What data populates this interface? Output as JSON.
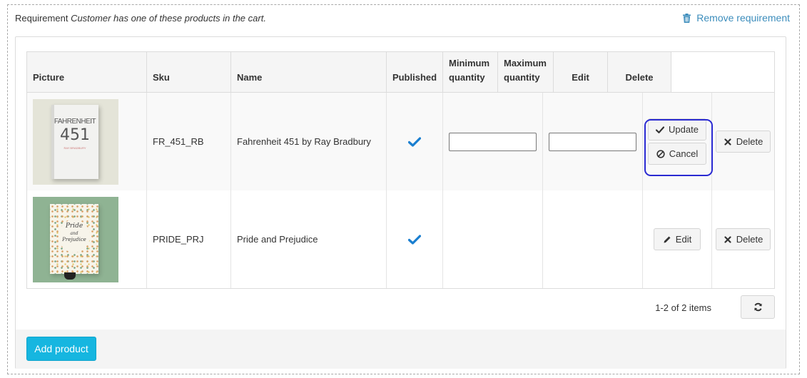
{
  "requirement": {
    "prefix": "Requirement",
    "description": "Customer has one of these products in the cart.",
    "remove_label": "Remove requirement"
  },
  "table": {
    "columns": {
      "picture": "Picture",
      "sku": "Sku",
      "name": "Name",
      "published": "Published",
      "min_qty_line1": "Minimum",
      "min_qty_line2": "quantity",
      "max_qty_line1": "Maximum",
      "max_qty_line2": "quantity",
      "edit": "Edit",
      "delete": "Delete"
    },
    "rows": [
      {
        "sku": "FR_451_RB",
        "name": "Fahrenheit 451 by Ray Bradbury",
        "published": true,
        "picture_title_line1": "FAHRENHEIT",
        "picture_title_line2": "451",
        "picture_author": "RAY BRADBURY",
        "min_quantity": "",
        "max_quantity": "",
        "update_label": "Update",
        "cancel_label": "Cancel",
        "delete_label": "Delete"
      },
      {
        "sku": "PRIDE_PRJ",
        "name": "Pride and Prejudice",
        "published": true,
        "picture_title_line1": "Pride",
        "picture_title_line2": "and",
        "picture_title_line3": "Prejudice",
        "edit_label": "Edit",
        "delete_label": "Delete"
      }
    ]
  },
  "pager": {
    "info": "1-2 of 2 items"
  },
  "add_product_label": "Add product",
  "icons": {
    "remove": "trash-icon",
    "published": "check-icon",
    "update": "check-icon",
    "cancel": "ban-icon",
    "edit": "pencil-icon",
    "delete": "times-icon",
    "refresh": "refresh-icon"
  },
  "colors": {
    "link": "#3c8dbc",
    "check": "#1a7fd0",
    "add_button": "#16b6e0",
    "highlight": "#2a2ad2"
  }
}
